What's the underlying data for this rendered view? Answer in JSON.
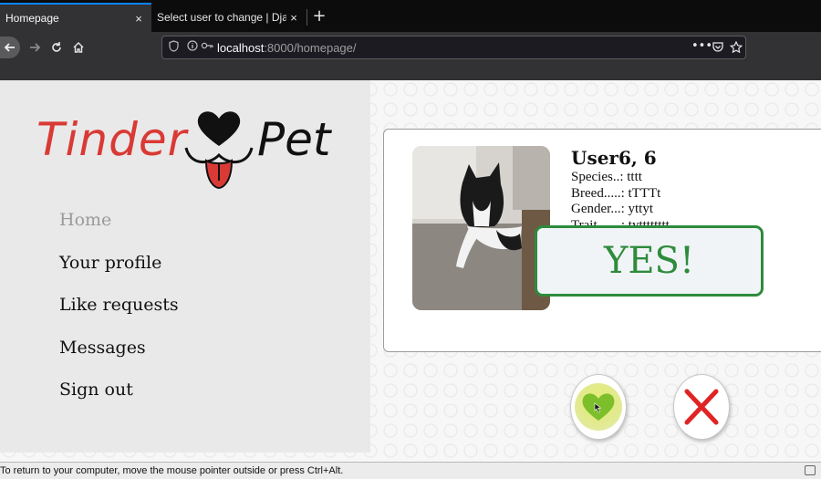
{
  "browser": {
    "tabs": [
      {
        "title": "Homepage",
        "active": true
      },
      {
        "title": "Select user to change | Djang",
        "active": false
      }
    ],
    "new_tab_label": "+",
    "close_glyph": "×",
    "url": {
      "host": "localhost",
      "rest": ":8000/homepage/"
    }
  },
  "logo": {
    "word1": "Tinder",
    "word2": "Pet"
  },
  "menu": {
    "items": [
      {
        "label": "Home",
        "active": true
      },
      {
        "label": "Your profile",
        "active": false
      },
      {
        "label": "Like requests",
        "active": false
      },
      {
        "label": "Messages",
        "active": false
      },
      {
        "label": "Sign out",
        "active": false
      }
    ]
  },
  "profile": {
    "name": "User6, 6",
    "species": "Species..: tttt",
    "breed": "Breed.....: tTTTt",
    "gender": "Gender...: yttyt",
    "trait": "Trait.......: tytttttttt"
  },
  "overlay": {
    "text": "YES!"
  },
  "status_bar": {
    "text": "To return to your computer, move the mouse pointer outside or press Ctrl+Alt."
  },
  "colors": {
    "brand_red": "#d93a35",
    "yes_green": "#2e8b3c",
    "like_green": "#7cbf2a",
    "nope_red": "#e02424"
  },
  "icons": [
    "back-arrow-icon",
    "forward-arrow-icon",
    "reload-icon",
    "home-icon",
    "shield-icon",
    "info-icon",
    "key-icon",
    "more-icon",
    "pocket-icon",
    "bookmark-star-icon",
    "heart-icon",
    "close-x-icon",
    "cursor-icon"
  ]
}
